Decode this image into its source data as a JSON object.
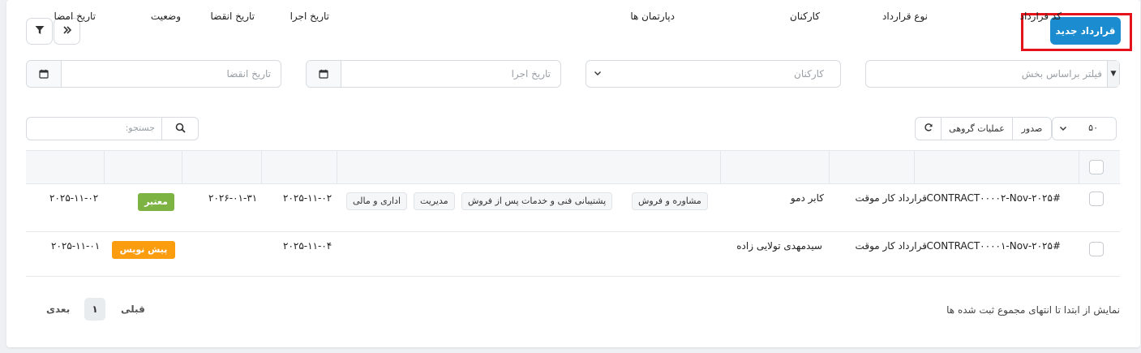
{
  "toolbar": {
    "new_contract_label": "قرارداد جدید",
    "filter_icon": "filter-icon",
    "collapse_icon": "double-chevron-right-icon"
  },
  "filters": {
    "section_placeholder": "فیلتر براساس بخش",
    "employees_placeholder": "کارکنان",
    "execution_date_placeholder": "تاریخ اجرا",
    "expiry_date_placeholder": "تاریخ انقضا"
  },
  "table_tools": {
    "page_size": "۵۰",
    "export_label": "صدور",
    "bulk_actions_label": "عملیات گروهی",
    "search_placeholder": "جستجو:"
  },
  "table": {
    "headers": {
      "code": "کد قرارداد",
      "type": "نوع قرارداد",
      "employees": "کارکنان",
      "departments": "دپارتمان ها",
      "exec_date": "تاریخ اجرا",
      "expiry_date": "تاریخ انقضا",
      "status": "وضعیت",
      "sign_date": "تاریخ امضا"
    },
    "rows": [
      {
        "code": "CONTRACT۰۰۰۰۲-Nov-۲۰۲۵#",
        "type": "قرارداد کار موقت",
        "employee": "کابر دمو",
        "departments": [
          "مشاوره و فروش",
          "پشتیبانی فنی و خدمات پس از فروش",
          "مدیریت",
          "اداری و مالی"
        ],
        "exec_date": "۲۰۲۵-۱۱-۰۲",
        "expiry_date": "۲۰۲۶-۰۱-۳۱",
        "status": "معتبر",
        "sign_date": "۲۰۲۵-۱۱-۰۲"
      },
      {
        "code": "CONTRACT۰۰۰۰۱-Nov-۲۰۲۵#",
        "type": "قرارداد کار موقت",
        "employee": "سیدمهدی تولایی زاده",
        "departments": [],
        "exec_date": "۲۰۲۵-۱۱-۰۴",
        "expiry_date": "",
        "status": "پیش نویس",
        "sign_date": "۲۰۲۵-۱۱-۰۱"
      }
    ]
  },
  "footer": {
    "summary": "نمایش از ابتدا تا انتهای مجموع ثبت شده ها",
    "prev_label": "قبلی",
    "next_label": "بعدی",
    "current_page": "۱"
  },
  "colors": {
    "primary": "#1b8ccf",
    "valid_badge": "#7cb342",
    "draft_badge": "#fb9d0f",
    "highlight": "#e3121b"
  }
}
